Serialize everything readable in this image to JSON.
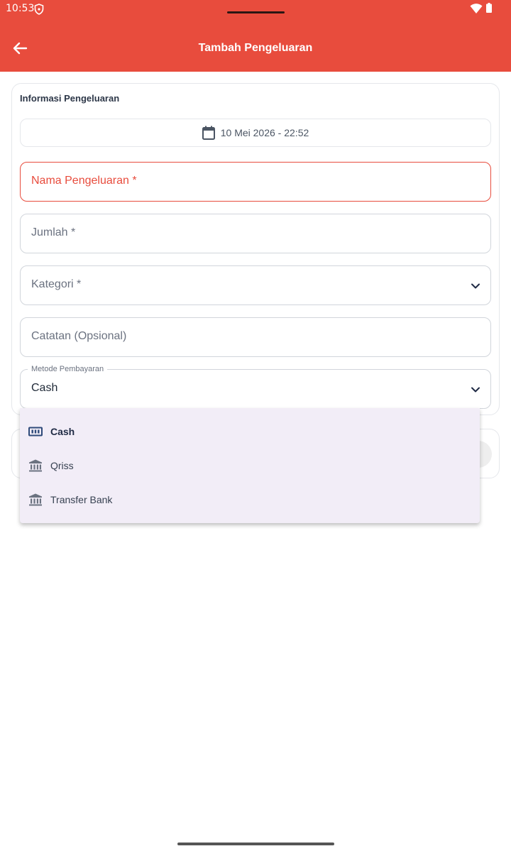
{
  "status_bar": {
    "time": "10:53"
  },
  "app_bar": {
    "title": "Tambah Pengeluaran"
  },
  "form": {
    "section_title": "Informasi Pengeluaran",
    "date": "10 Mei 2026 - 22:52",
    "name_placeholder": "Nama Pengeluaran *",
    "amount_placeholder": "Jumlah *",
    "category_placeholder": "Kategori *",
    "note_placeholder": "Catatan (Opsional)",
    "payment_label": "Metode Pembayaran",
    "payment_value": "Cash"
  },
  "payment_menu": {
    "items": [
      {
        "label": "Cash",
        "icon": "cash-icon",
        "selected": true
      },
      {
        "label": "Qriss",
        "icon": "bank-icon",
        "selected": false
      },
      {
        "label": "Transfer Bank",
        "icon": "bank-icon",
        "selected": false
      }
    ]
  },
  "colors": {
    "primary": "#e84c3d",
    "menu_background": "#f2edf7",
    "selected_icon": "#2f4a7a",
    "icon_muted": "#6b7280"
  }
}
